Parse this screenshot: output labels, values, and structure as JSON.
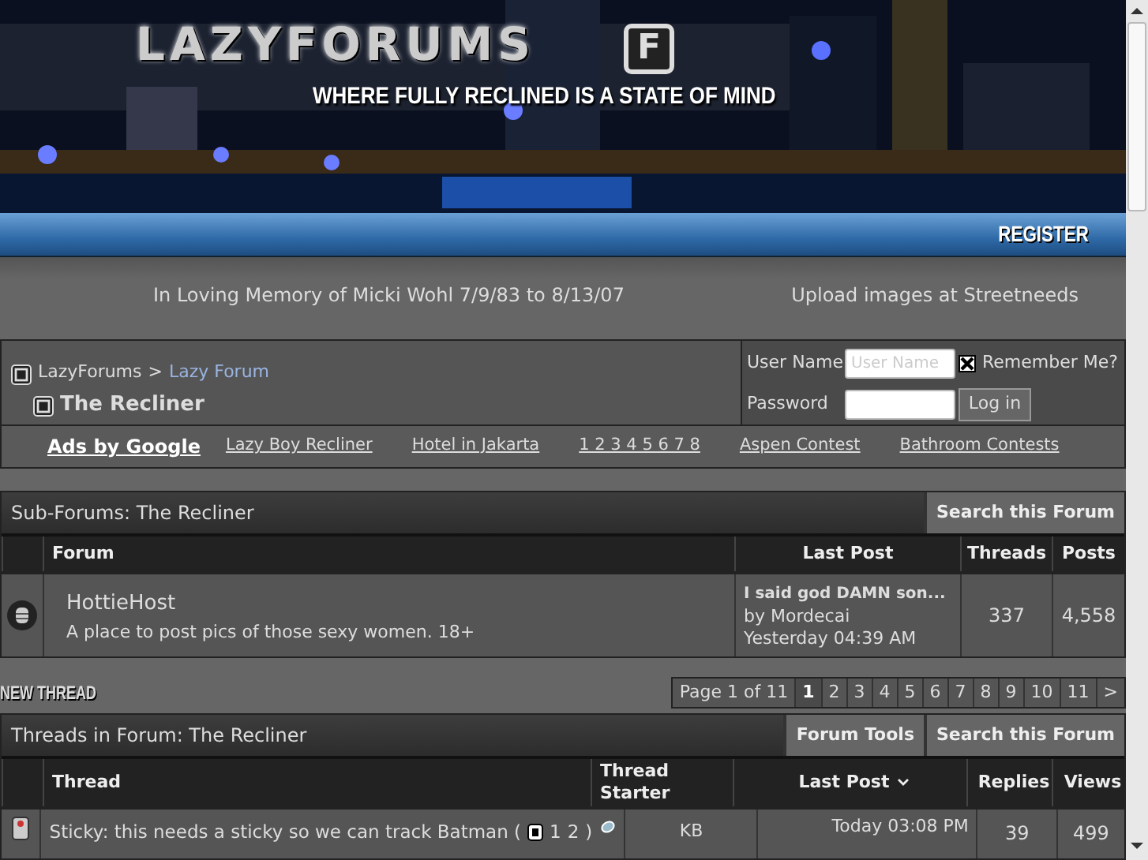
{
  "header": {
    "logo": "LAZYFORUMS",
    "logo_badge": "F",
    "tagline": "WHERE FULLY RECLINED IS A STATE OF MIND",
    "register": "REGISTER"
  },
  "notices": [
    "In Loving Memory of Micki Wohl 7/9/83 to 8/13/07",
    "Upload images at Streetneeds"
  ],
  "breadcrumb": {
    "items": [
      "LazyForums",
      "Lazy Forum"
    ],
    "separator": ">",
    "current": "The Recliner"
  },
  "login": {
    "username_label": "User Name",
    "username_placeholder": "User Name",
    "password_label": "Password",
    "remember_label": "Remember Me?",
    "remember_checked": true,
    "button": "Log in"
  },
  "ads": {
    "title": "Ads by Google",
    "links": [
      "Lazy Boy Recliner",
      "Hotel in Jakarta",
      "1 2 3 4 5 6 7 8",
      "Aspen Contest",
      "Bathroom Contests"
    ]
  },
  "subforums": {
    "title": "Sub-Forums: The Recliner",
    "tools": [
      "Search this Forum"
    ],
    "columns": [
      "Forum",
      "Last Post",
      "Threads",
      "Posts"
    ],
    "rows": [
      {
        "name": "HottieHost",
        "description": "A place to post pics of those sexy women. 18+",
        "last_post_title": "I said god DAMN son...",
        "last_post_by": "by Mordecai",
        "last_post_time": "Yesterday 04:39 AM",
        "threads": "337",
        "posts": "4,558"
      }
    ]
  },
  "new_thread": "NEW THREAD",
  "pagination": {
    "label": "Page 1 of 11",
    "pages": [
      {
        "label": "1",
        "selected": true
      },
      {
        "label": "2",
        "selected": false
      },
      {
        "label": "3",
        "selected": false
      },
      {
        "label": "4",
        "selected": false
      },
      {
        "label": "5",
        "selected": false
      },
      {
        "label": "6",
        "selected": false
      },
      {
        "label": "7",
        "selected": false
      },
      {
        "label": "8",
        "selected": false
      },
      {
        "label": "9",
        "selected": false
      },
      {
        "label": "10",
        "selected": false
      },
      {
        "label": "11",
        "selected": false
      }
    ],
    "next": ">"
  },
  "threads": {
    "title": "Threads in Forum: The Recliner",
    "tools": [
      "Forum Tools",
      "Search this Forum"
    ],
    "columns": [
      "Thread",
      "Thread Starter",
      "Last Post",
      "Replies",
      "Views"
    ],
    "rows": [
      {
        "title": "Sticky: this needs a sticky so we can track Batman (",
        "pages": [
          "1",
          "2"
        ],
        "pages_close": ")",
        "starter": "KB",
        "last_post_time": "Today 03:08 PM",
        "replies": "39",
        "views": "499"
      }
    ]
  }
}
